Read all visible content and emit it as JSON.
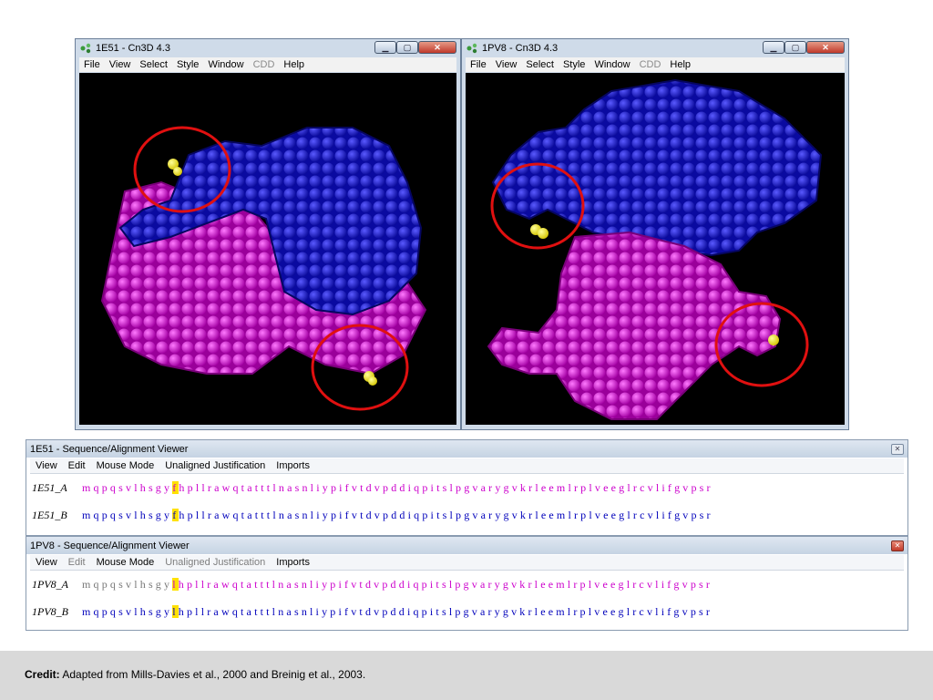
{
  "windows": {
    "left": {
      "title": "1E51 - Cn3D 4.3",
      "menu": [
        "File",
        "View",
        "Select",
        "Style",
        "Window",
        "CDD",
        "Help"
      ],
      "disabled_menu": [
        "CDD"
      ]
    },
    "right": {
      "title": "1PV8 - Cn3D 4.3",
      "menu": [
        "File",
        "View",
        "Select",
        "Style",
        "Window",
        "CDD",
        "Help"
      ],
      "disabled_menu": [
        "CDD"
      ]
    }
  },
  "sequence_viewers": [
    {
      "title": "1E51 - Sequence/Alignment Viewer",
      "menu": [
        "View",
        "Edit",
        "Mouse Mode",
        "Unaligned Justification",
        "Imports"
      ],
      "rows": [
        {
          "label": "1E51_A",
          "pre": "mqpqsvlhsgy",
          "hl": "f",
          "post": "hpllrawqtatttlnasnliypifvtdvpddiqpitslpgvarygvkrleemlrplveeglrcvlifgvpsr",
          "color": "#cc00cc"
        },
        {
          "label": "1E51_B",
          "pre": "mqpqsvlhsgy",
          "hl": "f",
          "post": "hpllrawqtatttlnasnliypifvtdvpddiqpitslpgvarygvkrleemlrplveeglrcvlifgvpsr",
          "color": "#0000bb"
        }
      ]
    },
    {
      "title": "1PV8 - Sequence/Alignment Viewer",
      "menu": [
        "View",
        "Edit",
        "Mouse Mode",
        "Unaligned Justification",
        "Imports"
      ],
      "rows": [
        {
          "label": "1PV8_A",
          "pre": "mqpqsvlhsgy",
          "hl": "l",
          "post": "hpllrawqtatttlnasnliypifvtdvpddiqpitslpgvarygvkrleemlrplveeglrcvlifgvpsr",
          "color": "#cc00cc"
        },
        {
          "label": "1PV8_B",
          "pre": "mqpqsvlhsgy",
          "hl": "l",
          "post": "hpllrawqtatttlnasnliypifvtdvpddiqpitslpgvarygvkrleemlrplveeglrcvlifgvpsr",
          "color": "#0000bb"
        }
      ]
    }
  ],
  "credit": {
    "label": "Credit:",
    "text": "Adapted from Mills-Davies et al., 2000 and Breinig et al., 2003."
  },
  "colors": {
    "chain_a": "#cc00cc",
    "chain_b": "#1a1aff",
    "highlight": "#ffe100",
    "circle": "#e01010"
  }
}
